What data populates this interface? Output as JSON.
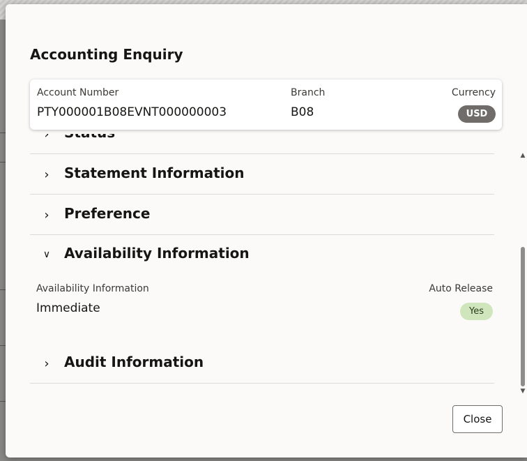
{
  "dialog": {
    "title": "Accounting Enquiry",
    "close_label": "Close"
  },
  "summary": {
    "account_number_label": "Account Number",
    "account_number_value": "PTY000001B08EVNT000000003",
    "branch_label": "Branch",
    "branch_value": "B08",
    "currency_label": "Currency",
    "currency_value": "USD"
  },
  "sections": [
    {
      "title": "Status",
      "expanded": false,
      "icon": "chevron-right-icon"
    },
    {
      "title": "Statement Information",
      "expanded": false,
      "icon": "chevron-right-icon"
    },
    {
      "title": "Preference",
      "expanded": false,
      "icon": "chevron-right-icon"
    },
    {
      "title": "Availability Information",
      "expanded": true,
      "icon": "chevron-down-icon"
    },
    {
      "title": "Audit Information",
      "expanded": false,
      "icon": "chevron-right-icon"
    }
  ],
  "availability": {
    "availability_label": "Availability Information",
    "availability_value": "Immediate",
    "auto_release_label": "Auto Release",
    "auto_release_value": "Yes"
  },
  "colors": {
    "currency_badge": "#6f6c69",
    "yes_badge": "#cfe6bd"
  }
}
